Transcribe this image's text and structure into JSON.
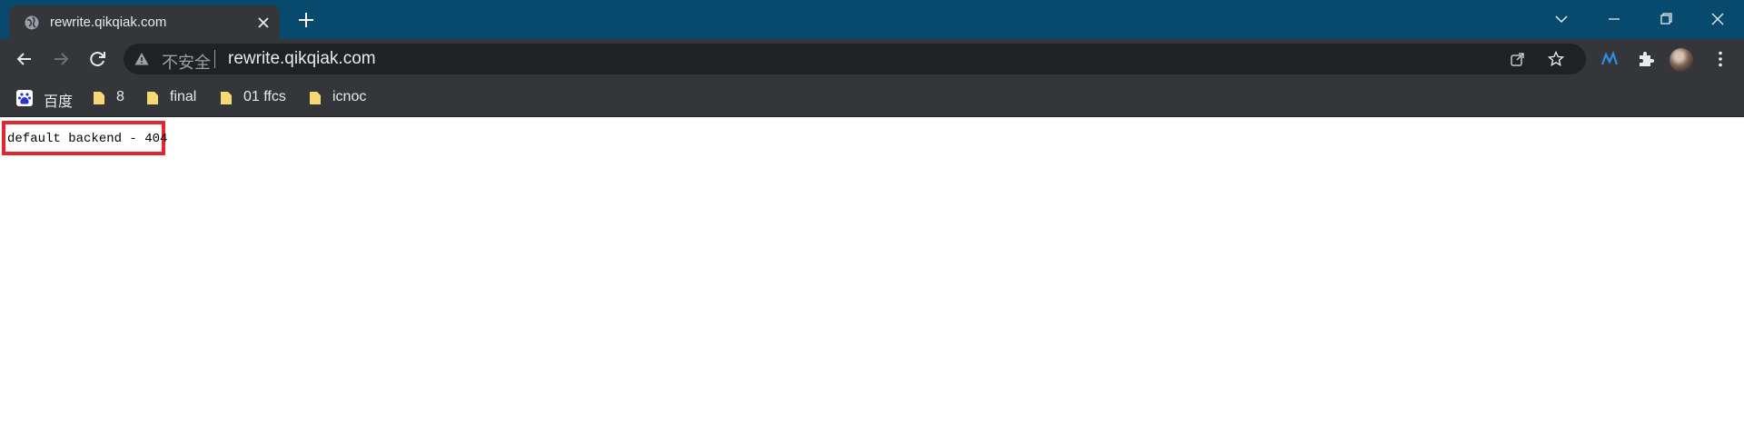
{
  "tab": {
    "title": "rewrite.qikqiak.com",
    "favicon": "globe-icon",
    "close_icon": "close-icon"
  },
  "new_tab_icon": "plus-icon",
  "window_controls": [
    "chevron-down-icon",
    "minimize-icon",
    "restore-icon",
    "close-icon"
  ],
  "toolbar": {
    "back_icon": "back-arrow-icon",
    "forward_icon": "forward-arrow-icon",
    "reload_icon": "reload-icon",
    "security_text": "不安全",
    "url": "rewrite.qikqiak.com",
    "share_icon": "share-icon",
    "bookmark_icon": "star-icon",
    "extension_icon": "extension-logo-icon",
    "puzzle_icon": "puzzle-icon",
    "menu_icon": "kebab-menu-icon"
  },
  "bookmarks": [
    {
      "label": "百度",
      "icon": "baidu-icon"
    },
    {
      "label": "8",
      "icon": "folder-icon"
    },
    {
      "label": "final",
      "icon": "folder-icon"
    },
    {
      "label": "01 ffcs",
      "icon": "folder-icon"
    },
    {
      "label": "icnoc",
      "icon": "folder-icon"
    }
  ],
  "page": {
    "body_text": "default backend - 404"
  },
  "colors": {
    "tab_strip": "#074a6e",
    "toolbar": "#35363a",
    "omnibox": "#202124",
    "highlight_border": "#e3262d",
    "folder": "#f8d775"
  }
}
